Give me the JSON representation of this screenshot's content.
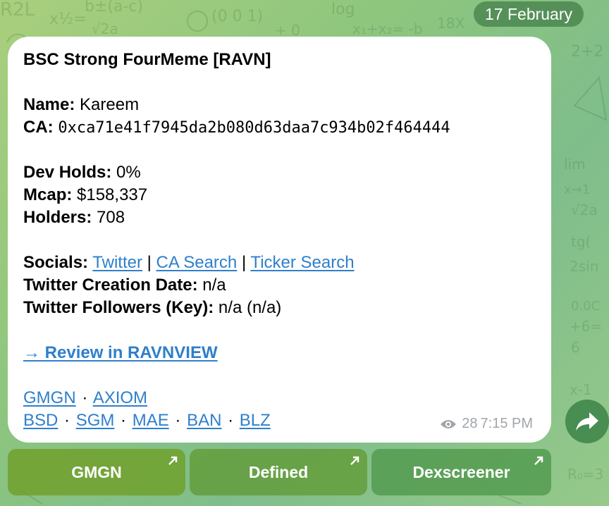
{
  "date_chip": "17 February",
  "message": {
    "title": "BSC Strong FourMeme [RAVN]",
    "name_label": "Name:",
    "name_value": "Kareem",
    "ca_label": "CA:",
    "ca_value": "0xca71e41f7945da2b080d63daa7c934b02f464444",
    "dev_holds_label": "Dev Holds:",
    "dev_holds_value": "0%",
    "mcap_label": "Mcap:",
    "mcap_value": "$158,337",
    "holders_label": "Holders:",
    "holders_value": "708",
    "socials_label": "Socials:",
    "socials_links": [
      "Twitter",
      "CA Search",
      "Ticker Search"
    ],
    "socials_separator": "|",
    "twitter_date_label": "Twitter Creation Date:",
    "twitter_date_value": "n/a",
    "twitter_followers_label": "Twitter Followers (Key):",
    "twitter_followers_value": "n/a (n/a)",
    "review_link": "→ Review in RAVNVIEW",
    "links_row1": [
      "GMGN",
      "AXIOM"
    ],
    "links_row2": [
      "BSD",
      "SGM",
      "MAE",
      "BAN",
      "BLZ"
    ],
    "link_separator": "·",
    "views": "28",
    "time": "7:15 PM"
  },
  "buttons": [
    "GMGN",
    "Defined",
    "Dexscreener"
  ],
  "colors": {
    "link": "#2f7fcb",
    "meta": "#a1a5aa",
    "bubble": "#ffffff",
    "button_text": "#ffffff"
  },
  "icons": {
    "views": "eye-icon",
    "forward": "share-arrow-icon",
    "button_external": "arrow-up-right-icon"
  }
}
